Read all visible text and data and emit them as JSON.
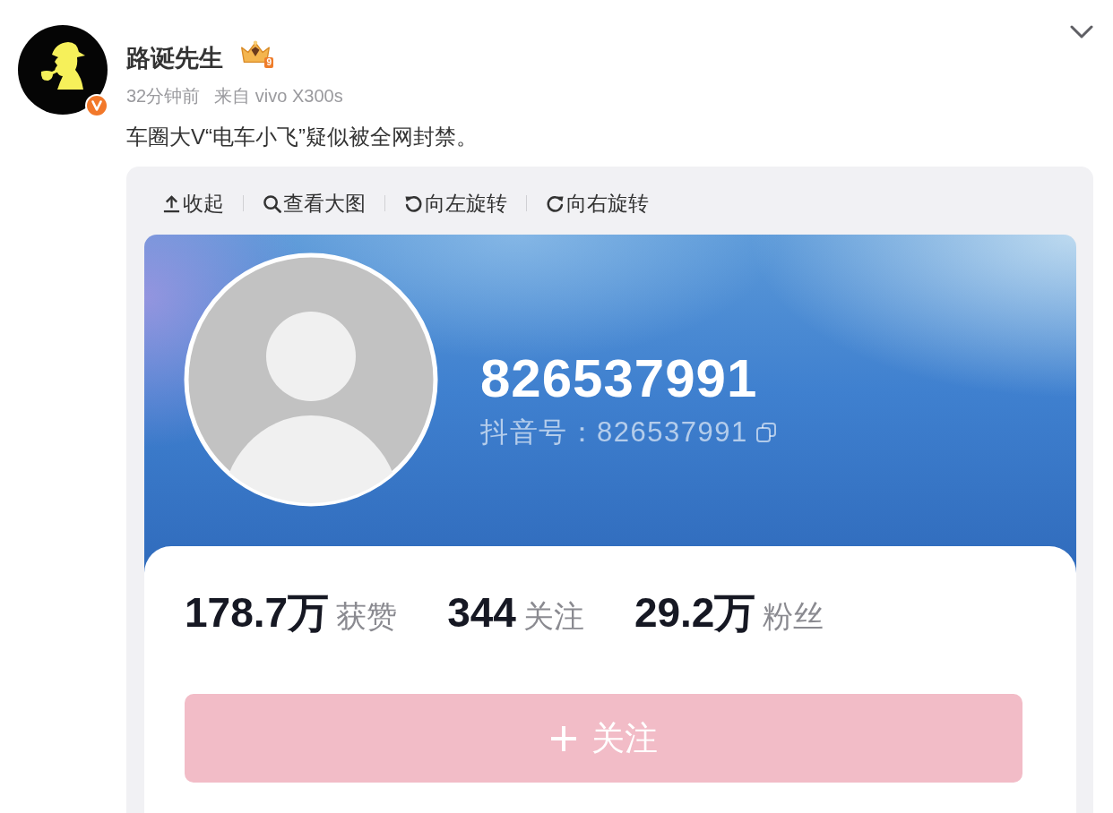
{
  "post": {
    "author": {
      "name": "路诞先生",
      "verified": true,
      "badge_level": "9"
    },
    "time": "32分钟前",
    "source": "来自 vivo X300s",
    "text": "车圈大V“电车小飞”疑似被全网封禁。",
    "image_toolbar": [
      {
        "kind": "collapse",
        "label": "收起"
      },
      {
        "kind": "view-large",
        "label": "查看大图"
      },
      {
        "kind": "rotate-left",
        "label": "向左旋转"
      },
      {
        "kind": "rotate-right",
        "label": "向右旋转"
      }
    ],
    "image": {
      "nickname": "826537991",
      "account_id": "抖音号：826537991",
      "stats": [
        {
          "count": "178.7万",
          "caption": "获赞"
        },
        {
          "count": "344",
          "caption": "关注"
        },
        {
          "count": "29.2万",
          "caption": "粉丝"
        }
      ],
      "follow_button": {
        "label": "关注"
      }
    }
  }
}
